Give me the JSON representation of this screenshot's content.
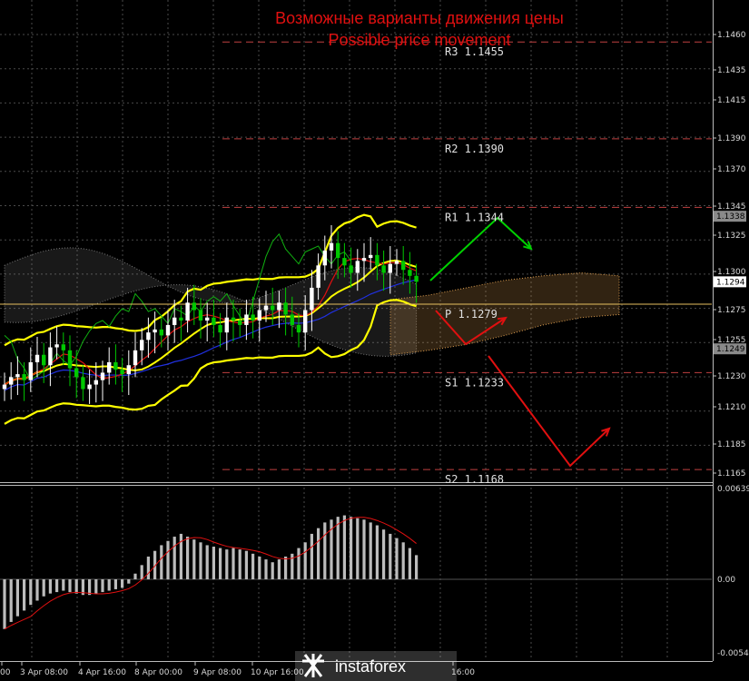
{
  "title": {
    "line1": "Возможные варианты движения цены",
    "line2": "Possible price movement"
  },
  "levels": [
    {
      "name": "R3",
      "label": "R3 1.1455",
      "value": 1.1455
    },
    {
      "name": "R2",
      "label": "R2 1.1390",
      "value": 1.139
    },
    {
      "name": "R1",
      "label": "R1 1.1344",
      "value": 1.1344
    },
    {
      "name": "P",
      "label": "P 1.1279",
      "value": 1.1279
    },
    {
      "name": "S1",
      "label": "S1 1.1233",
      "value": 1.1233
    },
    {
      "name": "S2",
      "label": "S2 1.1168",
      "value": 1.1168
    }
  ],
  "price_axis": [
    "1.1460",
    "1.1435",
    "1.1415",
    "1.1390",
    "1.1370",
    "1.1345",
    "1.1325",
    "1.1300",
    "1.1275",
    "1.1255",
    "1.1230",
    "1.1210",
    "1.1185",
    "1.1165"
  ],
  "price_badges": [
    {
      "label": "1.1338",
      "value": 1.1338,
      "color": "#8a8a8a"
    },
    {
      "label": "1.1294",
      "value": 1.1294,
      "color": "#ffffff"
    },
    {
      "label": "1.1249",
      "value": 1.1249,
      "color": "#8a8a8a"
    }
  ],
  "osc_axis": [
    "0.00639",
    "0.00",
    "-0.00543"
  ],
  "time_labels": [
    "00",
    "3 Apr 08:00",
    "4 Apr 16:00",
    "8 Apr 00:00",
    "9 Apr 08:00",
    "10 Apr 16:00",
    "16:00"
  ],
  "logo": {
    "text": "instaforex"
  },
  "colors": {
    "bull": "#ffffff",
    "bear": "#00c800",
    "bollinger": "#ffff00",
    "grid": "#4a4a4a",
    "title": "#e01010",
    "arrow_up": "#00d000",
    "arrow_down": "#e01010",
    "pivot": "#e8c060"
  },
  "chart_data": [
    {
      "type": "candlestick",
      "title": "Возможные варианты движения цены / Possible price movement",
      "ylim": [
        1.1155,
        1.1475
      ],
      "x_ticks": [
        "3 Apr 08:00",
        "4 Apr 16:00",
        "8 Apr 00:00",
        "9 Apr 08:00",
        "10 Apr 16:00"
      ],
      "series": [
        {
          "name": "Close",
          "values": [
            1.1225,
            1.123,
            1.1232,
            1.1228,
            1.124,
            1.1245,
            1.1238,
            1.125,
            1.1252,
            1.1248,
            1.1236,
            1.123,
            1.1222,
            1.1225,
            1.1228,
            1.1233,
            1.124,
            1.1235,
            1.1232,
            1.1238,
            1.1248,
            1.1255,
            1.126,
            1.1262,
            1.1258,
            1.1265,
            1.127,
            1.1268,
            1.128,
            1.1275,
            1.1268,
            1.127,
            1.1265,
            1.126,
            1.127,
            1.1268,
            1.1265,
            1.1272,
            1.1268,
            1.1275,
            1.1278,
            1.1275,
            1.128,
            1.1272,
            1.1265,
            1.126,
            1.1275,
            1.129,
            1.1305,
            1.1315,
            1.132,
            1.131,
            1.1305,
            1.13,
            1.1308,
            1.131,
            1.1312,
            1.1305,
            1.13,
            1.1306,
            1.1308,
            1.1302,
            1.1298,
            1.1294
          ]
        }
      ]
    },
    {
      "type": "bar",
      "title": "",
      "ylim": [
        -0.00543,
        0.00639
      ],
      "series": [
        {
          "name": "",
          "values": [
            -0.0035,
            -0.003,
            -0.0026,
            -0.0022,
            -0.0018,
            -0.0015,
            -0.0012,
            -0.001,
            -0.0009,
            -0.0008,
            -0.0009,
            -0.001,
            -0.0011,
            -0.0011,
            -0.001,
            -0.0009,
            -0.0008,
            -0.0007,
            -0.0006,
            -0.0003,
            0.0004,
            0.001,
            0.0016,
            0.002,
            0.0024,
            0.0027,
            0.003,
            0.0032,
            0.003,
            0.0028,
            0.0026,
            0.0024,
            0.0023,
            0.0022,
            0.0021,
            0.0022,
            0.0021,
            0.002,
            0.0018,
            0.0016,
            0.0014,
            0.0012,
            0.0014,
            0.0016,
            0.0018,
            0.0022,
            0.0026,
            0.0032,
            0.0036,
            0.004,
            0.0042,
            0.0044,
            0.0045,
            0.0044,
            0.0043,
            0.0042,
            0.004,
            0.0038,
            0.0035,
            0.0032,
            0.0029,
            0.0026,
            0.0022,
            0.0017
          ]
        }
      ]
    }
  ]
}
